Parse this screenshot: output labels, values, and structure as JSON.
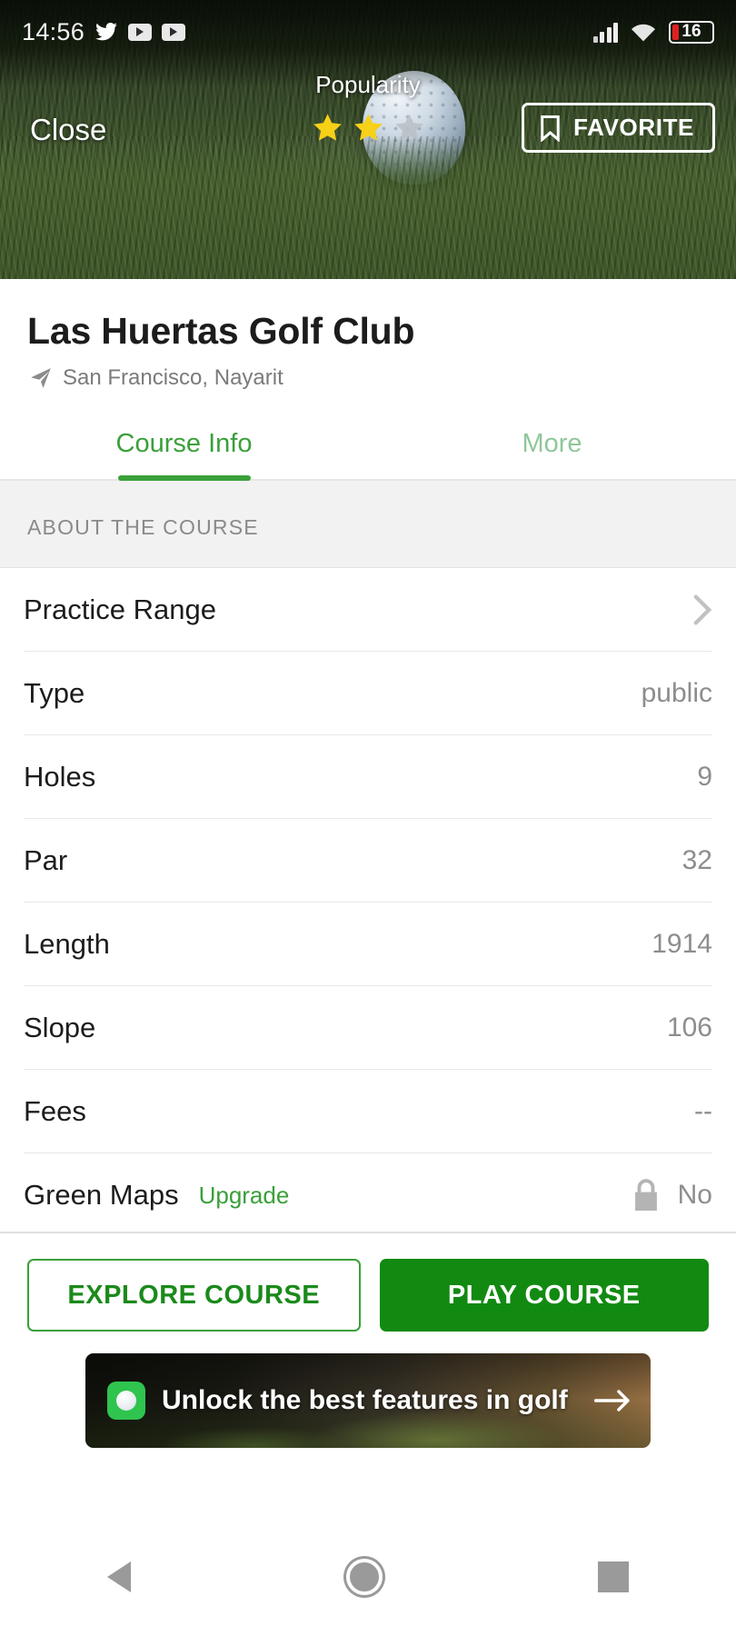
{
  "status_bar": {
    "time": "14:56",
    "left_icons": [
      "twitter-icon",
      "youtube-icon",
      "youtube-icon"
    ],
    "right_icons": [
      "cellular-signal-icon",
      "wifi-icon",
      "battery-icon"
    ],
    "battery_level": "16"
  },
  "hero": {
    "close_label": "Close",
    "popularity_label": "Popularity",
    "stars_filled": 2,
    "stars_total": 3,
    "favorite_label": "FAVORITE",
    "background": "golf-ball-on-grass-photo"
  },
  "header": {
    "course_name": "Las Huertas Golf Club",
    "location": "San Francisco, Nayarit",
    "location_icon": "navigation-arrow-icon"
  },
  "tabs": [
    {
      "label": "Course Info",
      "active": true
    },
    {
      "label": "More",
      "active": false
    }
  ],
  "section": {
    "title": "ABOUT THE COURSE"
  },
  "rows": [
    {
      "label": "Practice Range",
      "value": "",
      "accessory": "chevron-right-icon"
    },
    {
      "label": "Type",
      "value": "public",
      "accessory": ""
    },
    {
      "label": "Holes",
      "value": "9",
      "accessory": ""
    },
    {
      "label": "Par",
      "value": "32",
      "accessory": ""
    },
    {
      "label": "Length",
      "value": "1914",
      "accessory": ""
    },
    {
      "label": "Slope",
      "value": "106",
      "accessory": ""
    },
    {
      "label": "Fees",
      "value": "--",
      "accessory": ""
    },
    {
      "label": "Green Maps",
      "value": "No",
      "accessory": "lock-icon",
      "link": "Upgrade"
    }
  ],
  "cta": {
    "explore_label": "EXPLORE COURSE",
    "play_label": "PLAY COURSE"
  },
  "promo": {
    "text": "Unlock the best features in golf",
    "badge_icon": "golf-ball-icon",
    "arrow_icon": "arrow-right-icon"
  },
  "nav_bar": {
    "back": "back-triangle-icon",
    "home": "home-circle-icon",
    "recents": "recents-square-icon"
  },
  "colors": {
    "accent_green": "#3aa03a",
    "solid_green": "#128a12",
    "muted_green": "#8fc79a",
    "star_yellow": "#f7d117",
    "star_gray": "#b9bfc4",
    "value_gray": "#8d8d8d",
    "battery_red": "#e02020"
  }
}
